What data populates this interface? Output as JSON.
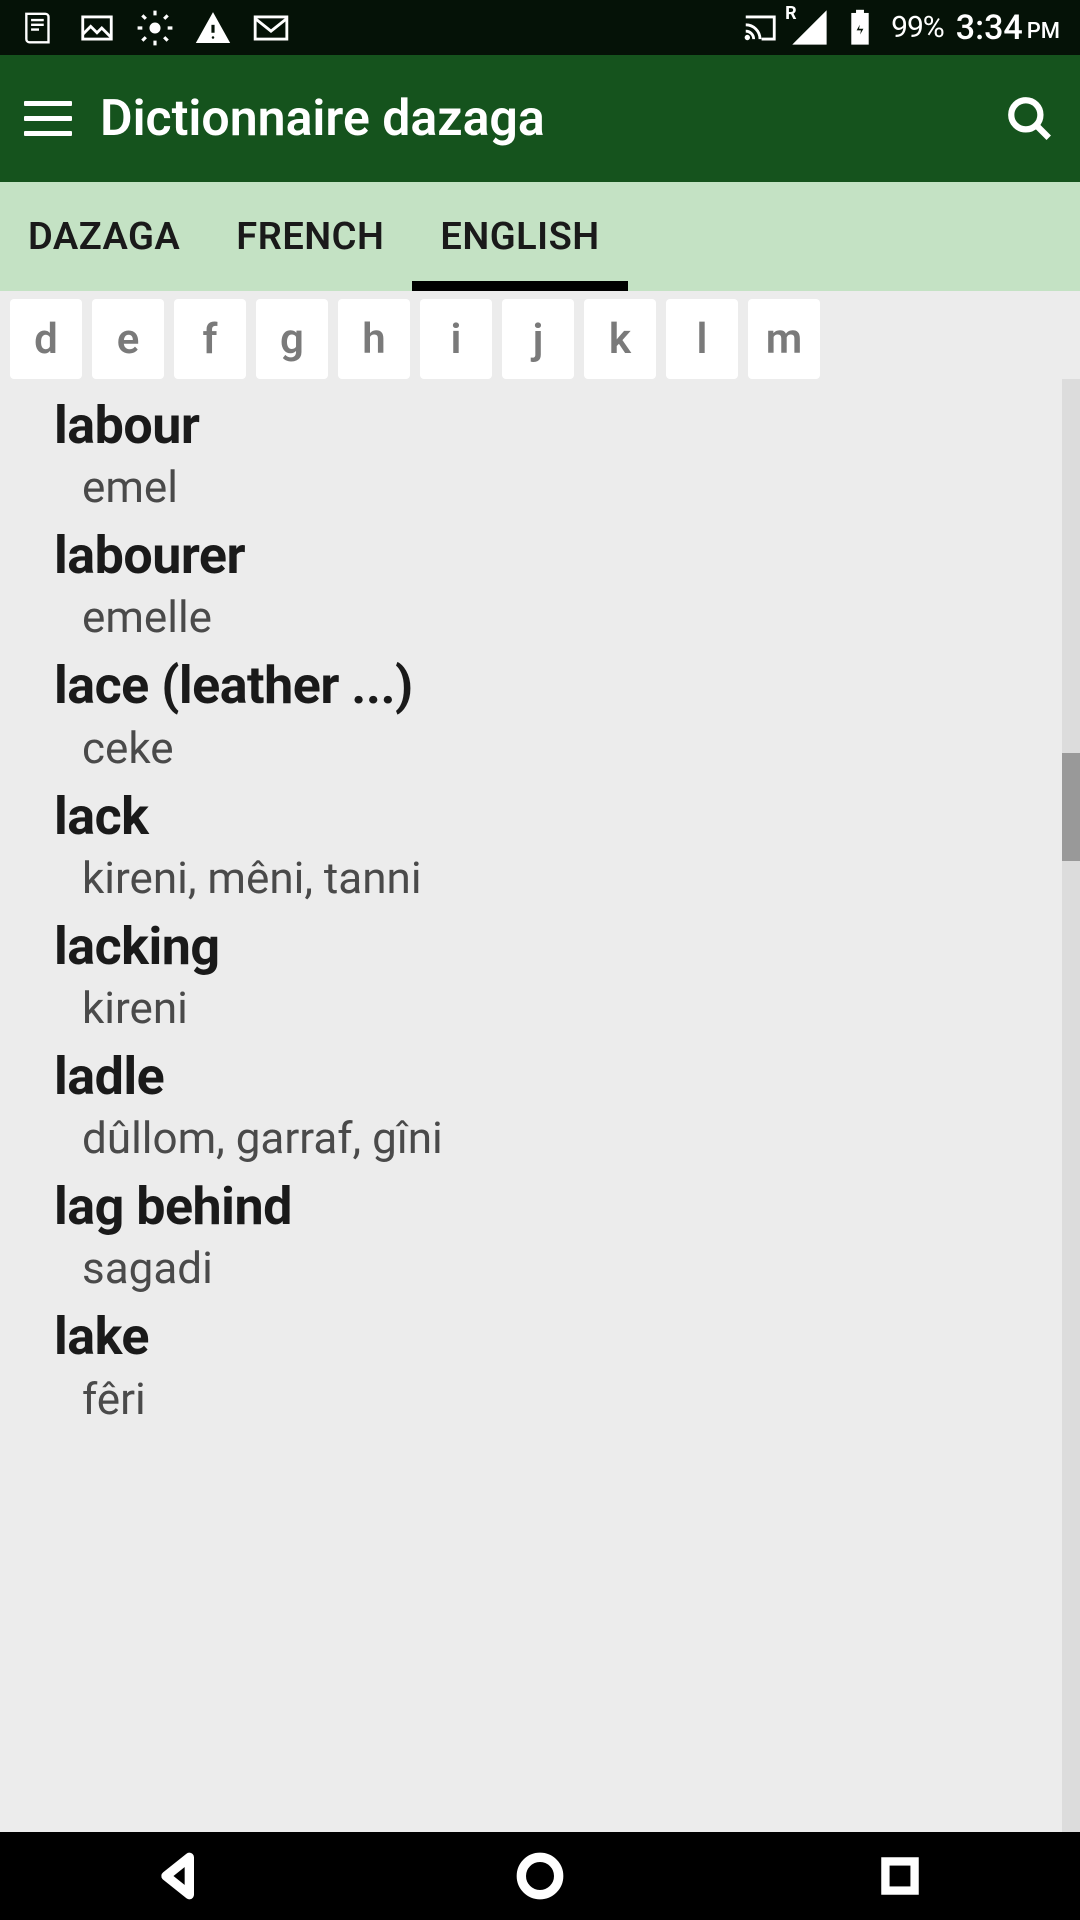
{
  "status": {
    "battery_pct": "99%",
    "time": "3:34",
    "ampm": "PM",
    "signal_badge": "R"
  },
  "header": {
    "title": "Dictionnaire dazaga"
  },
  "tabs": {
    "items": [
      {
        "label": "DAZAGA",
        "active": false
      },
      {
        "label": "FRENCH",
        "active": false
      },
      {
        "label": "ENGLISH",
        "active": true
      }
    ]
  },
  "alphabet": {
    "letters": [
      "d",
      "e",
      "f",
      "g",
      "h",
      "i",
      "j",
      "k",
      "l",
      "m"
    ]
  },
  "entries": [
    {
      "head": "labour",
      "def": "emel"
    },
    {
      "head": "labourer",
      "def": "emelle"
    },
    {
      "head": "lace (leather ...)",
      "def": "ceke"
    },
    {
      "head": "lack",
      "def": "kireni, mêni, tanni"
    },
    {
      "head": "lacking",
      "def": "kireni"
    },
    {
      "head": "ladle",
      "def": "dûllom, garraf, gîni"
    },
    {
      "head": "lag behind",
      "def": "sagadi"
    },
    {
      "head": "lake",
      "def": "fêri"
    }
  ],
  "colors": {
    "header_bg": "#15531d",
    "tab_bg": "#c4e2c4",
    "list_bg": "#ececec"
  }
}
